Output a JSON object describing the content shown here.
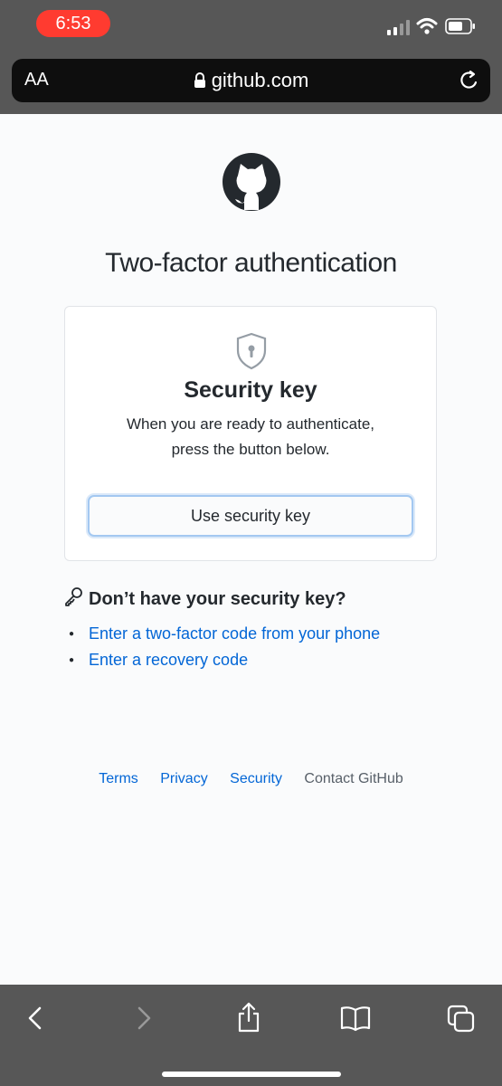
{
  "status": {
    "time": "6:53"
  },
  "browser": {
    "text_size_label": "AA",
    "url": "github.com"
  },
  "page": {
    "title": "Two-factor authentication",
    "card": {
      "heading": "Security key",
      "description_line1": "When you are ready to authenticate,",
      "description_line2": "press the button below.",
      "button_label": "Use security key"
    },
    "alternatives": {
      "heading": "Don’t have your security key?",
      "links": [
        "Enter a two-factor code from your phone",
        "Enter a recovery code"
      ]
    },
    "footer": {
      "terms": "Terms",
      "privacy": "Privacy",
      "security": "Security",
      "contact": "Contact GitHub"
    }
  },
  "colors": {
    "link": "#0366d6",
    "text": "#24292e",
    "chrome": "#575757",
    "time_pill": "#ff3b30"
  },
  "icons": [
    "lock-icon",
    "reload-icon",
    "github-logo-icon",
    "shield-icon",
    "key-icon",
    "back-icon",
    "forward-icon",
    "share-icon",
    "bookmarks-icon",
    "tabs-icon"
  ]
}
